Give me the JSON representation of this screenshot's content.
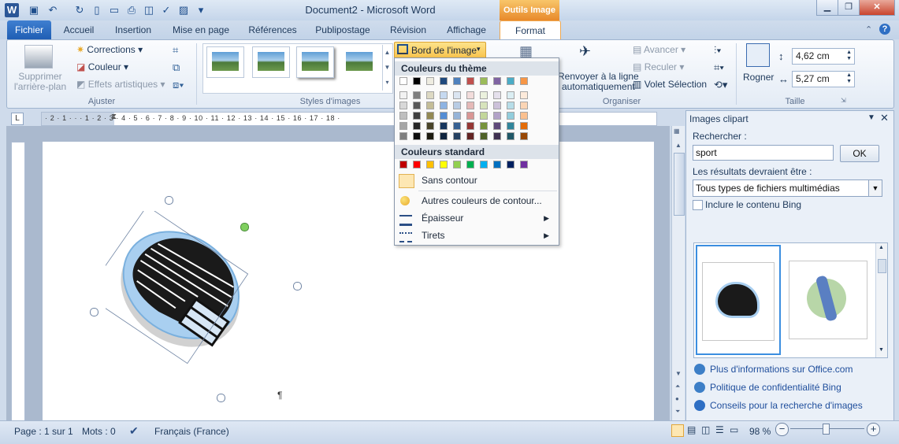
{
  "title_bar": {
    "document_title": "Document2 - Microsoft Word",
    "tools_tab": "Outils Image"
  },
  "tabs": [
    "Fichier",
    "Accueil",
    "Insertion",
    "Mise en page",
    "Références",
    "Publipostage",
    "Révision",
    "Affichage",
    "Format"
  ],
  "ribbon": {
    "adjust": {
      "remove_bg": "Supprimer\nl'arrière-plan",
      "corrections": "Corrections",
      "color": "Couleur",
      "artistic": "Effets artistiques",
      "label": "Ajuster"
    },
    "styles": {
      "label": "Styles d'images"
    },
    "border_button": "Bord de l'image",
    "arrange": {
      "wrap": "Renvoyer à la ligne\nautomatiquement",
      "forward": "Avancer",
      "backward": "Reculer",
      "selection_pane": "Volet Sélection",
      "label": "Organiser"
    },
    "crop": "Rogner",
    "size": {
      "height": "4,62 cm",
      "width": "5,27 cm",
      "label": "Taille"
    }
  },
  "border_menu": {
    "theme_header": "Couleurs du thème",
    "standard_header": "Couleurs standard",
    "theme_top": [
      "#ffffff",
      "#000000",
      "#eeece1",
      "#1f497d",
      "#4f81bd",
      "#c0504d",
      "#9bbb59",
      "#8064a2",
      "#4bacc6",
      "#f79646"
    ],
    "theme_shades": [
      [
        "#f2f2f2",
        "#d8d8d8",
        "#bfbfbf",
        "#a5a5a5",
        "#7f7f7f"
      ],
      [
        "#7f7f7f",
        "#595959",
        "#3f3f3f",
        "#262626",
        "#0c0c0c"
      ],
      [
        "#ddd9c3",
        "#c4bd97",
        "#938953",
        "#494429",
        "#1d1b10"
      ],
      [
        "#c6d9f0",
        "#8db3e2",
        "#548dd4",
        "#17365d",
        "#0f243e"
      ],
      [
        "#dbe5f1",
        "#b8cce4",
        "#95b3d7",
        "#366092",
        "#244061"
      ],
      [
        "#f2dcdb",
        "#e5b9b7",
        "#d99694",
        "#953734",
        "#632423"
      ],
      [
        "#ebf1dd",
        "#d7e3bc",
        "#c3d69b",
        "#76923c",
        "#4f6128"
      ],
      [
        "#e5e0ec",
        "#ccc1d9",
        "#b2a2c7",
        "#5f497a",
        "#3f3151"
      ],
      [
        "#dbeef3",
        "#b7dde8",
        "#92cddc",
        "#31859b",
        "#205867"
      ],
      [
        "#fdeada",
        "#fbd5b5",
        "#fac08f",
        "#e36c09",
        "#974806"
      ]
    ],
    "standard": [
      "#c00000",
      "#ff0000",
      "#ffc000",
      "#ffff00",
      "#92d050",
      "#00b050",
      "#00b0f0",
      "#0070c0",
      "#002060",
      "#7030a0"
    ],
    "no_outline": "Sans contour",
    "more_colors": "Autres couleurs de contour...",
    "weight": "Épaisseur",
    "dashes": "Tirets"
  },
  "task_pane": {
    "title": "Images clipart",
    "search_label": "Rechercher :",
    "search_value": "sport",
    "ok": "OK",
    "results_label": "Les résultats devraient être :",
    "media_type": "Tous types de fichiers multimédias",
    "include_bing": "Inclure le contenu Bing",
    "links": [
      "Plus d'informations sur Office.com",
      "Politique de confidentialité Bing",
      "Conseils pour la recherche d'images"
    ]
  },
  "status_bar": {
    "page": "Page : 1 sur 1",
    "words": "Mots : 0",
    "language": "Français (France)",
    "zoom": "98 %"
  },
  "paragraph_mark": "¶",
  "ruler_numbers": "· 2 · 1 · · · 1 · 2 · 3 · 4 · 5 · 6 · 7 · 8 · 9 · 10 · 11 · 12 · 13 · 14 · 15 · 16 · 17 · 18 ·"
}
